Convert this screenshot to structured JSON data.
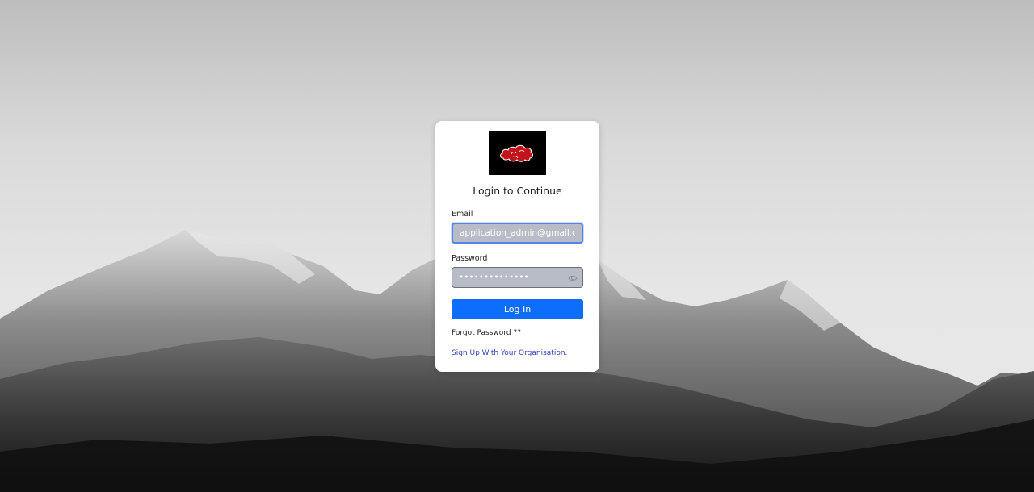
{
  "login": {
    "heading": "Login to Continue",
    "email": {
      "label": "Email",
      "value": "application_admin@gmail.co"
    },
    "password": {
      "label": "Password",
      "masked_value": "••••••••••••••"
    },
    "submit_label": "Log In",
    "forgot_password_label": "Forgot Password ??",
    "signup_label": "Sign Up With Your Organisation."
  },
  "icons": {
    "logo": "red-cloud-logo",
    "password_toggle": "eye-icon"
  },
  "colors": {
    "primary_button": "#0d6efd",
    "input_fill": "#b8bcc6",
    "input_focus_border": "#4f86e8",
    "logo_background": "#000000",
    "logo_cloud": "#c0131b",
    "signup_link": "#3446b8"
  }
}
